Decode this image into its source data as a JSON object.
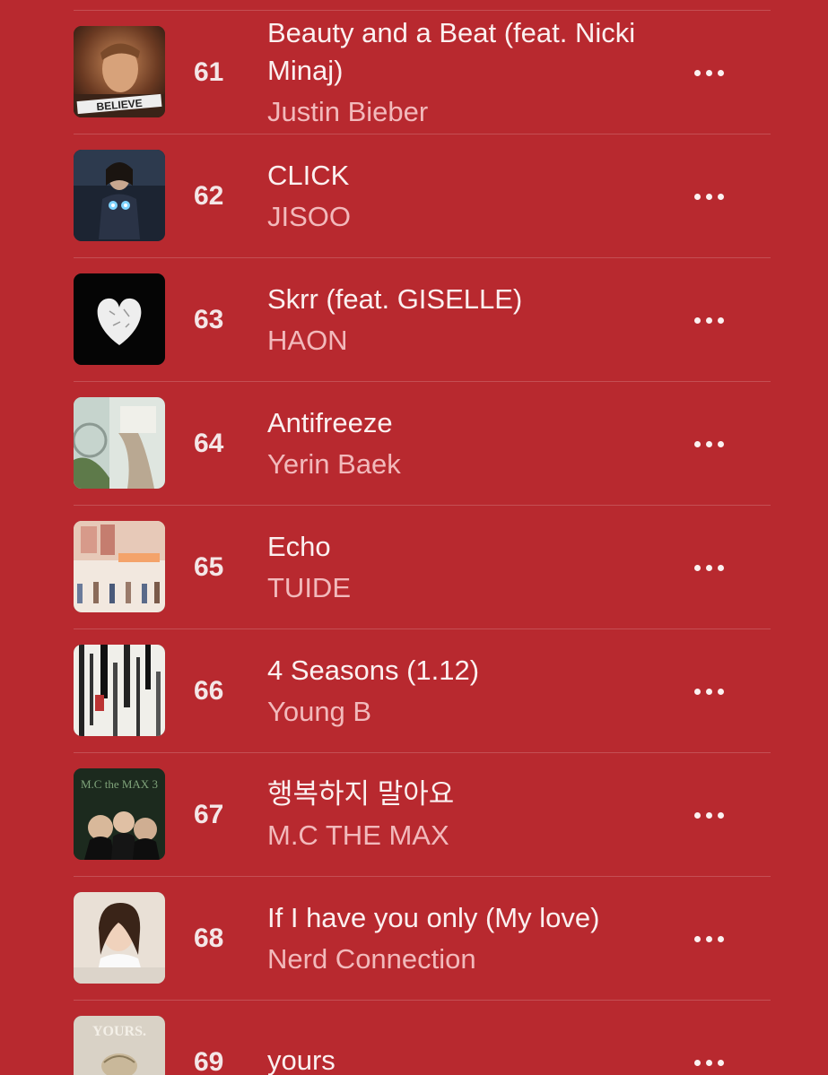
{
  "tracks": [
    {
      "rank": "61",
      "title": "Beauty and a Beat (feat. Nicki Minaj)",
      "artist": "Justin Bieber",
      "art_text": "BELIEVE",
      "art_icon": "album-art-believe"
    },
    {
      "rank": "62",
      "title": "CLICK",
      "artist": "JISOO",
      "art_icon": "album-art-jisoo"
    },
    {
      "rank": "63",
      "title": "Skrr (feat. GISELLE)",
      "artist": "HAON",
      "art_icon": "album-art-heart"
    },
    {
      "rank": "64",
      "title": "Antifreeze",
      "artist": "Yerin Baek",
      "art_icon": "album-art-antifreeze"
    },
    {
      "rank": "65",
      "title": "Echo",
      "artist": "TUIDE",
      "art_icon": "album-art-echo"
    },
    {
      "rank": "66",
      "title": "4 Seasons (1.12)",
      "artist": "Young B",
      "art_icon": "album-art-4seasons"
    },
    {
      "rank": "67",
      "title": "행복하지 말아요",
      "artist": "M.C THE MAX",
      "art_text": "M.C the MAX 3",
      "art_icon": "album-art-mcthemax"
    },
    {
      "rank": "68",
      "title": "If I have you only (My love)",
      "artist": "Nerd Connection",
      "art_icon": "album-art-portrait"
    },
    {
      "rank": "69",
      "title": "yours",
      "artist": "",
      "art_text": "YOURS.",
      "art_icon": "album-art-yours"
    }
  ],
  "colors": {
    "background": "#b8292f",
    "title": "#fbf0f0",
    "artist": "#f2b9bb",
    "rank": "#f4e6e7"
  }
}
